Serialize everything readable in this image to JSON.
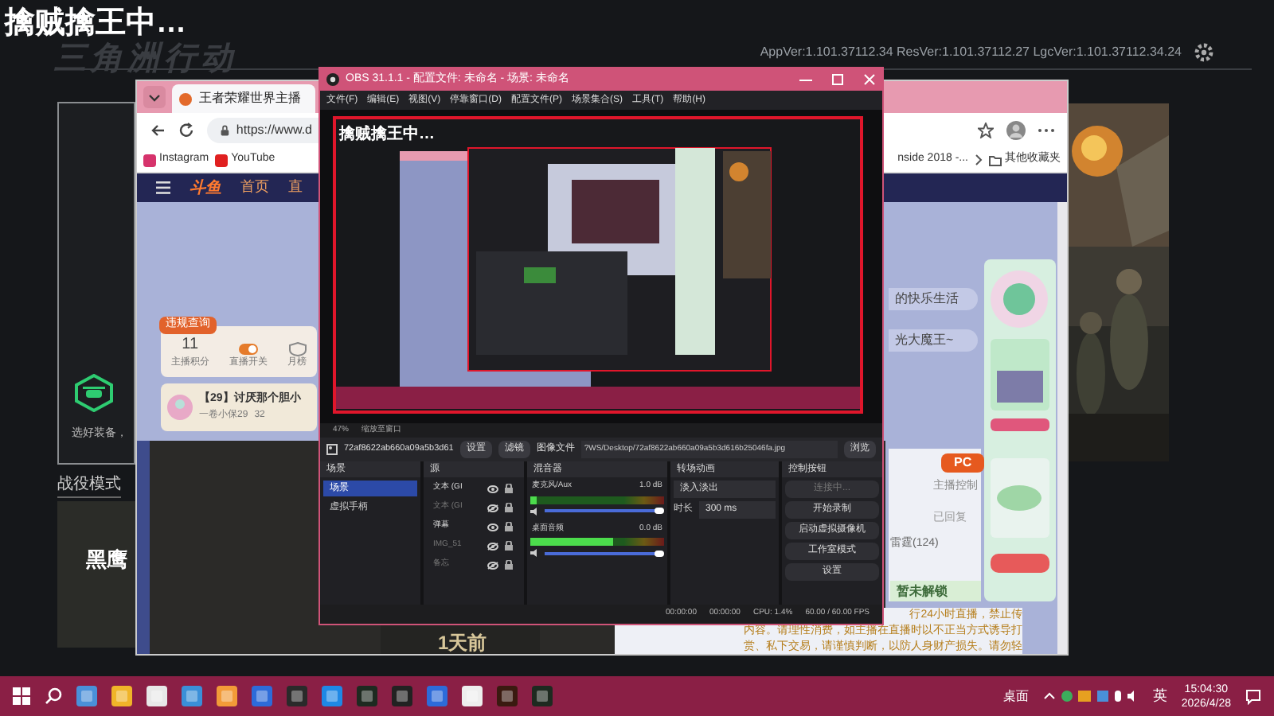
{
  "launcher": {
    "banner": "擒贼擒王中…",
    "logo": "三角洲行动",
    "versions": "AppVer:1.101.37112.34  ResVer:1.101.37112.27  LgcVer:1.101.37112.34.24",
    "card_caption": "选好装备，",
    "section": "战役模式",
    "mode_title": "黑鹰"
  },
  "browser": {
    "tab_title": "王者荣耀世界主播",
    "url": "https://www.d",
    "bookmarks": [
      "Instagram",
      "YouTube",
      "nside 2018 -...",
      "其他收藏夹"
    ],
    "site_logo": "斗鱼",
    "nav": [
      "首页",
      "直"
    ],
    "stats": [
      {
        "value": "11",
        "label": "主播积分"
      },
      {
        "label": "直播开关"
      },
      {
        "label": "月榜"
      }
    ],
    "badge": "违规查询",
    "room_title": "【29】讨厌那个胆小",
    "room_owner": "一卷小保29",
    "room_count": "32",
    "player_time": "1天前",
    "chips": [
      "的快乐生活",
      "光大魔王~"
    ],
    "pc_button": "PC",
    "host_control": "主播控制",
    "replied": "已回复",
    "thunder": "雷霆(124)",
    "locked": "暂未解锁",
    "notice": [
      "行24小时直播，禁止传",
      "内容。请理性消费，如主播在直播时以不正当方式诱导打",
      "赏、私下交易，请谨慎判断，以防人身财产损失。请勿轻"
    ]
  },
  "obs": {
    "title": "OBS 31.1.1 - 配置文件: 未命名 - 场景: 未命名",
    "menu": [
      "文件(F)",
      "编辑(E)",
      "视图(V)",
      "停靠窗口(D)",
      "配置文件(P)",
      "场景集合(S)",
      "工具(T)",
      "帮助(H)"
    ],
    "preview_banner": "擒贼擒王中…",
    "zoom": "47%",
    "zoom_mode": "缩放至窗口",
    "source_name": "72af8622ab660a09a5b3d61",
    "settings_button": "设置",
    "filters_button": "滤镜",
    "file_label": "图像文件",
    "file_path": "?WS/Desktop/72af8622ab660a09a5b3d616b25046fa.jpg",
    "browse_button": "浏览",
    "scenes": {
      "title": "场景",
      "items": [
        {
          "label": "场景",
          "selected": true
        },
        {
          "label": "虚拟手柄",
          "selected": false
        }
      ]
    },
    "sources": {
      "title": "源",
      "items": [
        {
          "label": "文本 (GI",
          "visible": true
        },
        {
          "label": "文本 (GI",
          "visible": false
        },
        {
          "label": "弹幕",
          "visible": true
        },
        {
          "label": "IMG_51",
          "visible": false
        },
        {
          "label": "备忘",
          "visible": false
        }
      ]
    },
    "mixer": {
      "title": "混音器",
      "channels": [
        {
          "name": "麦克风/Aux",
          "reading": "1.0 dB",
          "meter": {
            "level": 0.05
          },
          "fader": {
            "level": 1
          }
        },
        {
          "name": "桌面音频",
          "reading": "0.0 dB",
          "meter": {
            "level": 0.62
          },
          "fader": {
            "level": 1
          }
        }
      ]
    },
    "transitions": {
      "title": "转场动画",
      "type": "淡入淡出",
      "duration_label": "时长",
      "duration": "300 ms"
    },
    "controls": {
      "title": "控制按钮",
      "buttons": [
        {
          "label": "连接中...",
          "disabled": true
        },
        {
          "label": "开始录制",
          "disabled": false
        },
        {
          "label": "启动虚拟摄像机",
          "disabled": false
        },
        {
          "label": "工作室模式",
          "disabled": false
        },
        {
          "label": "设置",
          "disabled": false
        }
      ]
    },
    "status": {
      "stream_time": "00:00:00",
      "record_time": "00:00:00",
      "cpu": "CPU: 1.4%",
      "fps": "60.00 / 60.00 FPS"
    }
  },
  "taskbar": {
    "desktop_label": "桌面",
    "ime": "英",
    "time": "15:04:30",
    "date": "2026/4/28"
  }
}
